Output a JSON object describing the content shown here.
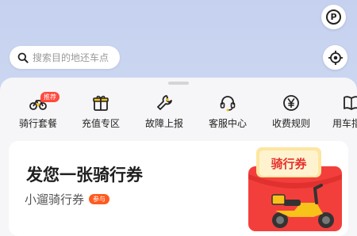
{
  "map": {
    "parking_label": "P",
    "search_placeholder": "搜索目的地还车点"
  },
  "shortcuts": [
    {
      "label": "骑行套餐",
      "icon": "bike-icon",
      "badge": "推荐"
    },
    {
      "label": "充值专区",
      "icon": "gift-icon"
    },
    {
      "label": "故障上报",
      "icon": "wrench-icon"
    },
    {
      "label": "客服中心",
      "icon": "headset-icon"
    },
    {
      "label": "收费规则",
      "icon": "yen-icon"
    },
    {
      "label": "用车指南",
      "icon": "book-icon"
    }
  ],
  "promo": {
    "title": "发您一张骑行券",
    "subtitle": "小遛骑行券",
    "tag": "参与",
    "coupon_text": "骑行券"
  },
  "colors": {
    "accent_yellow": "#f7c21a",
    "badge_red": "#ff4a3d",
    "coupon_red": "#f33f3c"
  }
}
